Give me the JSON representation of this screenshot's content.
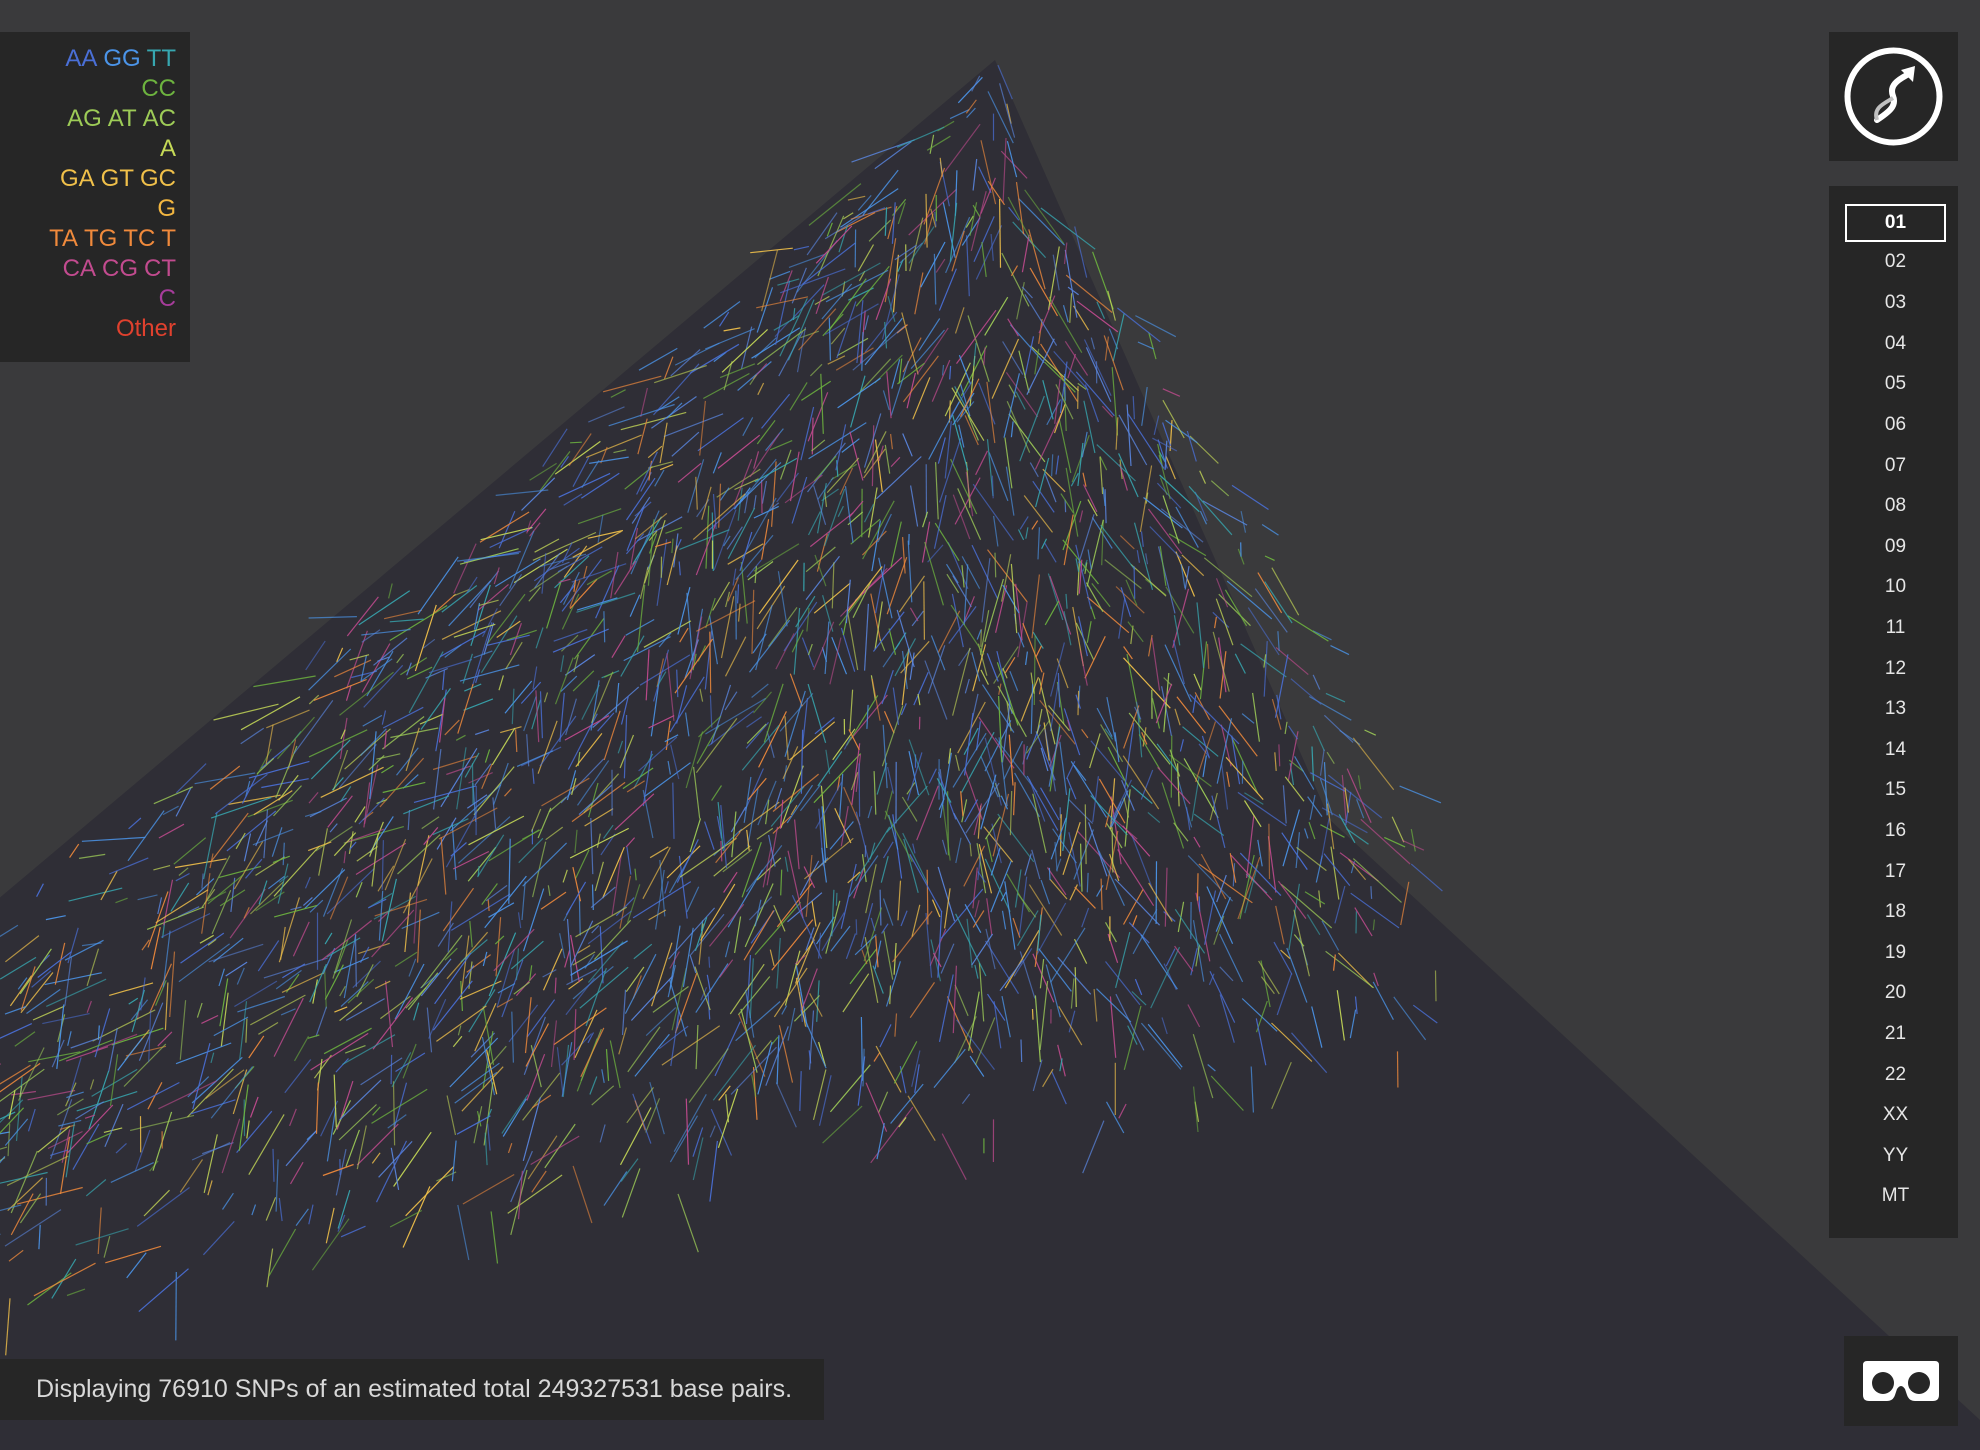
{
  "legend": {
    "rows": [
      [
        {
          "text": "AA",
          "color": "#4a6fd6"
        },
        {
          "text": "GG",
          "color": "#4b94e8"
        },
        {
          "text": "TT",
          "color": "#37a7b0"
        }
      ],
      [
        {
          "text": "CC",
          "color": "#6db33f"
        }
      ],
      [
        {
          "text": "AG",
          "color": "#9dcb57"
        },
        {
          "text": "AT",
          "color": "#9dcb57"
        },
        {
          "text": "AC",
          "color": "#9dcb57"
        }
      ],
      [
        {
          "text": "A",
          "color": "#c5d957"
        }
      ],
      [
        {
          "text": "GA",
          "color": "#f0c04a"
        },
        {
          "text": "GT",
          "color": "#f0c04a"
        },
        {
          "text": "GC",
          "color": "#f0c04a"
        }
      ],
      [
        {
          "text": "G",
          "color": "#f2b640"
        }
      ],
      [
        {
          "text": "TA",
          "color": "#f08a3c"
        },
        {
          "text": "TG",
          "color": "#f08a3c"
        },
        {
          "text": "TC",
          "color": "#f08a3c"
        },
        {
          "text": "T",
          "color": "#f08a3c"
        }
      ],
      [
        {
          "text": "CA",
          "color": "#c24b8f"
        },
        {
          "text": "CG",
          "color": "#c24b8f"
        },
        {
          "text": "CT",
          "color": "#c24b8f"
        }
      ],
      [
        {
          "text": "C",
          "color": "#a63c9a"
        }
      ],
      [
        {
          "text": "Other",
          "color": "#e0412e"
        }
      ]
    ]
  },
  "logo": {
    "icon": "dna-arrow-logo-icon"
  },
  "chromosomes": {
    "selected": "01",
    "items": [
      "01",
      "02",
      "03",
      "04",
      "05",
      "06",
      "07",
      "08",
      "09",
      "10",
      "11",
      "12",
      "13",
      "14",
      "15",
      "16",
      "17",
      "18",
      "19",
      "20",
      "21",
      "22",
      "XX",
      "YY",
      "MT"
    ]
  },
  "status": {
    "text": "Displaying 76910 SNPs of an estimated total 249327531 base pairs."
  },
  "vr_button": {
    "icon": "vr-goggles-icon"
  },
  "colors": {
    "background": "#3a3a3c",
    "panel": "#262626",
    "plane": "#2f2e36"
  }
}
